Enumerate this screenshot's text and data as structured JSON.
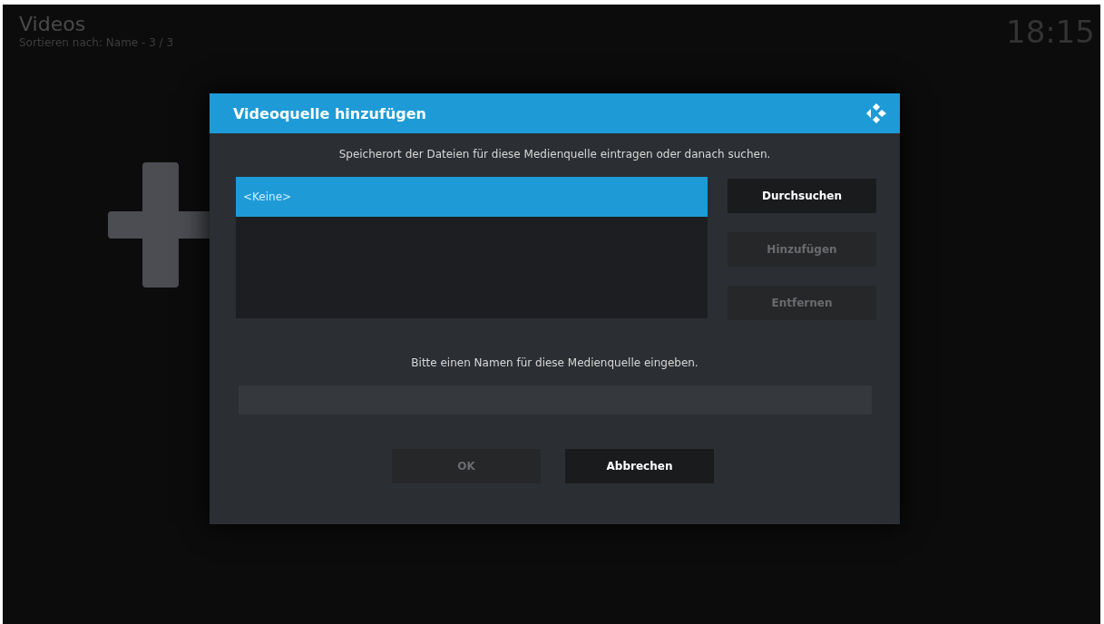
{
  "header": {
    "title": "Videos",
    "subtitle": "Sortieren nach: Name - 3 / 3",
    "clock": "18:15"
  },
  "dialog": {
    "title": "Videoquelle hinzufügen",
    "instruction": "Speicherort der Dateien für diese Medienquelle eintragen oder danach suchen.",
    "sources": [
      {
        "label": "<Keine>",
        "selected": true
      }
    ],
    "side_buttons": [
      {
        "label": "Durchsuchen",
        "disabled": false
      },
      {
        "label": "Hinzufügen",
        "disabled": true
      },
      {
        "label": "Entfernen",
        "disabled": true
      }
    ],
    "name_prompt": "Bitte einen Namen für diese Medienquelle eingeben.",
    "footer_buttons": [
      {
        "label": "OK",
        "disabled": true
      },
      {
        "label": "Abbrechen",
        "disabled": false
      }
    ]
  }
}
